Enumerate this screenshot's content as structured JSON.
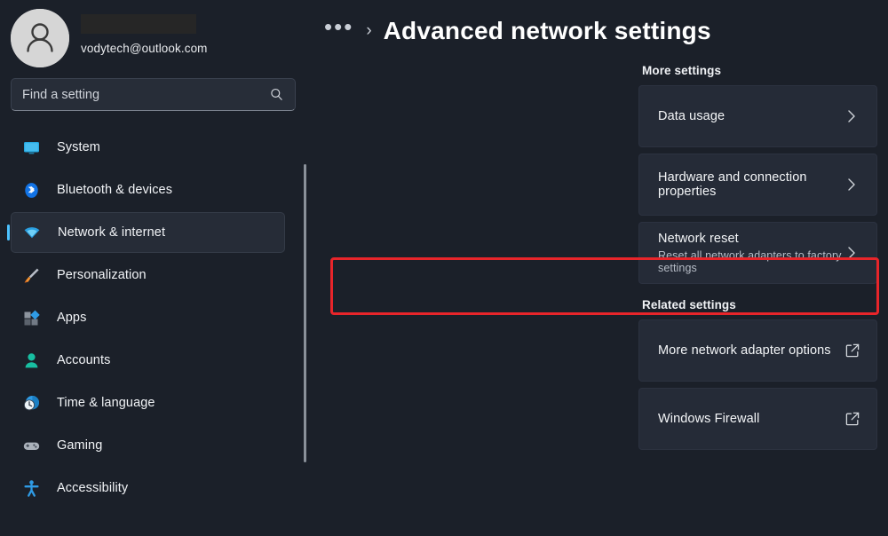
{
  "account": {
    "name_redacted": true,
    "email": "vodytech@outlook.com",
    "avatar_icon": "person-avatar-icon"
  },
  "search": {
    "placeholder": "Find a setting",
    "value": "",
    "icon": "search-icon"
  },
  "sidebar": {
    "items": [
      {
        "label": "System",
        "icon": "monitor-icon",
        "active": false
      },
      {
        "label": "Bluetooth & devices",
        "icon": "bluetooth-icon",
        "active": false
      },
      {
        "label": "Network & internet",
        "icon": "wifi-icon",
        "active": true
      },
      {
        "label": "Personalization",
        "icon": "paintbrush-icon",
        "active": false
      },
      {
        "label": "Apps",
        "icon": "apps-icon",
        "active": false
      },
      {
        "label": "Accounts",
        "icon": "person-icon",
        "active": false
      },
      {
        "label": "Time & language",
        "icon": "clock-globe-icon",
        "active": false
      },
      {
        "label": "Gaming",
        "icon": "gamepad-icon",
        "active": false
      },
      {
        "label": "Accessibility",
        "icon": "accessibility-icon",
        "active": false
      }
    ]
  },
  "header": {
    "breadcrumb_overflow": "•••",
    "breadcrumb_separator": "›",
    "title": "Advanced network settings"
  },
  "main": {
    "sections": [
      {
        "heading": "More settings",
        "cards": [
          {
            "title": "Data usage",
            "subtitle": "",
            "action_icon": "chevron-right-icon",
            "highlighted": false
          },
          {
            "title": "Hardware and connection properties",
            "subtitle": "",
            "action_icon": "chevron-right-icon",
            "highlighted": false
          },
          {
            "title": "Network reset",
            "subtitle": "Reset all network adapters to factory settings",
            "action_icon": "chevron-right-icon",
            "highlighted": true
          }
        ]
      },
      {
        "heading": "Related settings",
        "cards": [
          {
            "title": "More network adapter options",
            "subtitle": "",
            "action_icon": "external-link-icon",
            "highlighted": false
          },
          {
            "title": "Windows Firewall",
            "subtitle": "",
            "action_icon": "external-link-icon",
            "highlighted": false
          }
        ]
      }
    ]
  },
  "colors": {
    "page_background": "#1b2029",
    "card_background": "#252b37",
    "accent": "#4cc2ff",
    "annotation_red": "#e8252a",
    "text_primary": "#f4f6f8",
    "text_secondary": "#b6bcc6"
  }
}
